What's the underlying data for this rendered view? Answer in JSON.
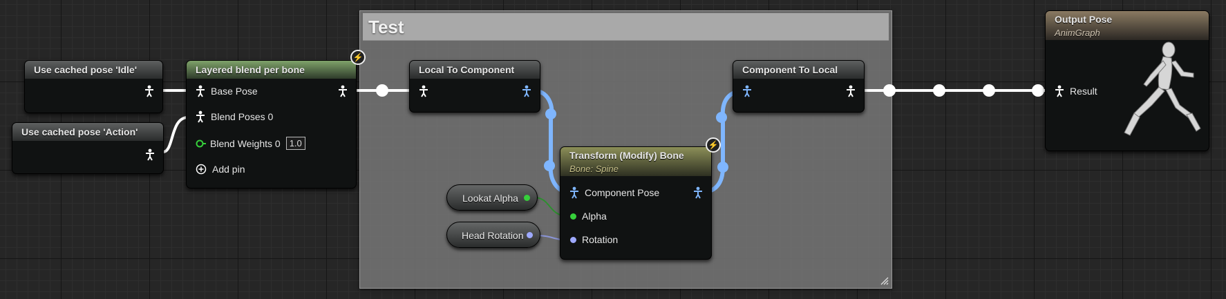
{
  "comment": {
    "title": "Test"
  },
  "nodes": {
    "cached_idle": {
      "title": "Use cached pose 'Idle'"
    },
    "cached_action": {
      "title": "Use cached pose 'Action'"
    },
    "layered_blend": {
      "title": "Layered blend per bone",
      "base_pose": "Base Pose",
      "blend_poses": "Blend Poses 0",
      "blend_weights": "Blend Weights 0",
      "blend_weights_value": "1.0",
      "add_pin": "Add pin"
    },
    "local_to_component": {
      "title": "Local To Component"
    },
    "component_to_local": {
      "title": "Component To Local"
    },
    "transform_bone": {
      "title": "Transform (Modify) Bone",
      "subtitle": "Bone: Spine",
      "component_pose": "Component Pose",
      "alpha": "Alpha",
      "rotation": "Rotation"
    },
    "lookat_alpha": {
      "label": "Lookat Alpha"
    },
    "head_rotation": {
      "label": "Head Rotation"
    },
    "output_pose": {
      "title": "Output Pose",
      "subtitle": "AnimGraph",
      "result": "Result"
    }
  },
  "colors": {
    "pose_wire": "#ffffff",
    "component_space_pin": "#7fb6ff",
    "float_pin": "#36d03b",
    "rotator_pin": "#9ea9ff"
  },
  "icons": {
    "pose": "pose-icon",
    "fast_path": "lightning-icon",
    "add": "plus-circle-icon"
  }
}
